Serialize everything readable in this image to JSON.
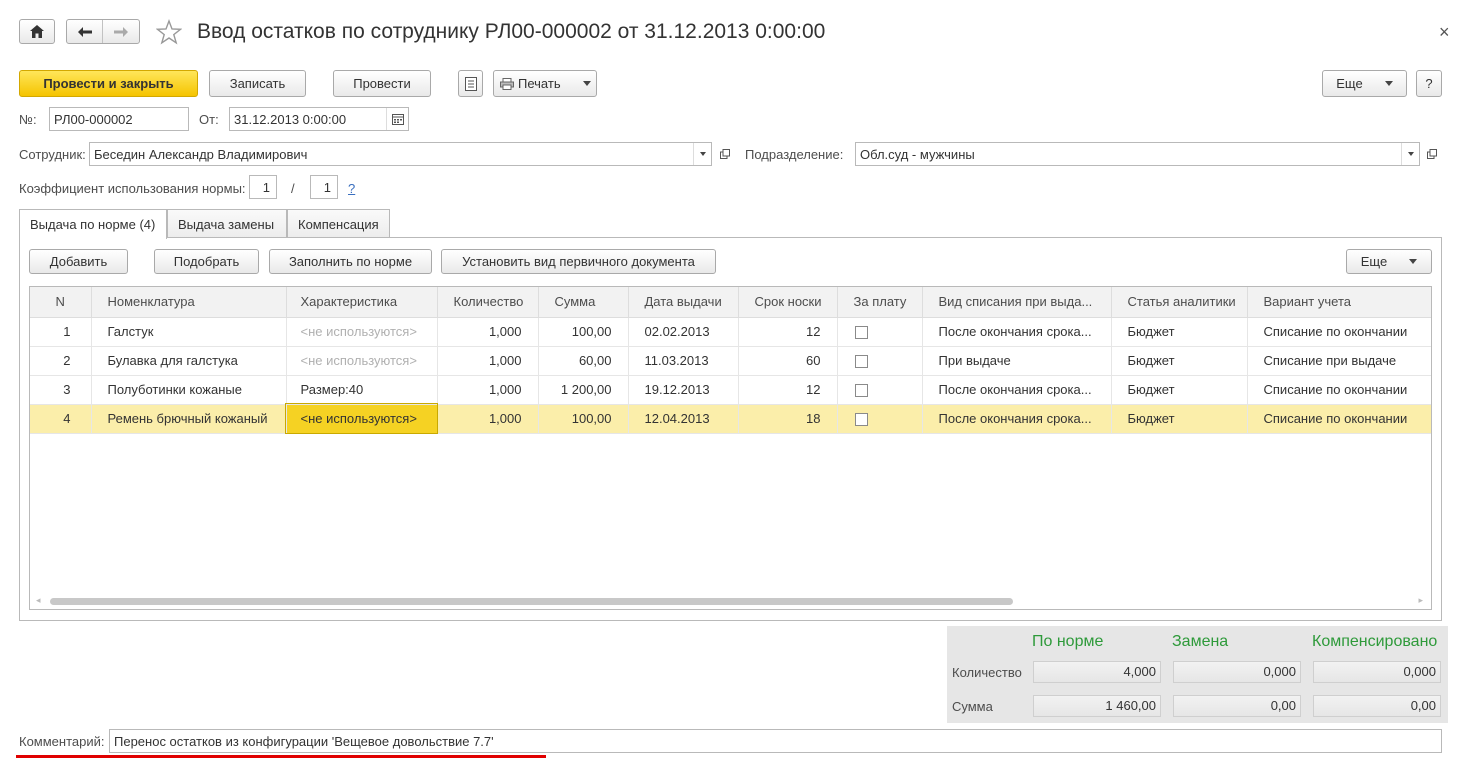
{
  "window": {
    "title": "Ввод остатков по сотруднику РЛ00-000002 от 31.12.2013 0:00:00"
  },
  "toolbar": {
    "post_close": "Провести и закрыть",
    "save": "Записать",
    "post": "Провести",
    "print": "Печать",
    "more": "Еще",
    "help": "?"
  },
  "header": {
    "number_label": "№:",
    "number_value": "РЛ00-000002",
    "date_label": "От:",
    "date_value": "31.12.2013  0:00:00",
    "employee_label": "Сотрудник:",
    "employee_value": "Беседин Александр Владимирович",
    "department_label": "Подразделение:",
    "department_value": "Обл.суд - мужчины",
    "coef_label": "Коэффициент использования нормы:",
    "coef_num": "1",
    "coef_sep": "/",
    "coef_den": "1",
    "coef_help": "?"
  },
  "tabs": [
    {
      "label": "Выдача по норме (4)"
    },
    {
      "label": "Выдача замены"
    },
    {
      "label": "Компенсация"
    }
  ],
  "table_toolbar": {
    "add": "Добавить",
    "pick": "Подобрать",
    "fill": "Заполнить по норме",
    "set_doc_type": "Установить вид первичного документа",
    "more": "Еще"
  },
  "table": {
    "columns": [
      "N",
      "Номенклатура",
      "Характеристика",
      "Количество",
      "Сумма",
      "Дата выдачи",
      "Срок носки",
      "За плату",
      "Вид списания при выда...",
      "Статья аналитики",
      "Вариант учета"
    ],
    "rows": [
      {
        "n": "1",
        "item": "Галстук",
        "char": "<не используются>",
        "qty": "1,000",
        "sum": "100,00",
        "date": "02.02.2013",
        "term": "12",
        "writeoff": "После окончания срока...",
        "article": "Бюджет",
        "variant": "Списание по окончании"
      },
      {
        "n": "2",
        "item": "Булавка для галстука",
        "char": "<не используются>",
        "qty": "1,000",
        "sum": "60,00",
        "date": "11.03.2013",
        "term": "60",
        "writeoff": "При выдаче",
        "article": "Бюджет",
        "variant": "Списание при выдаче"
      },
      {
        "n": "3",
        "item": "Полуботинки кожаные",
        "char": "Размер:40",
        "qty": "1,000",
        "sum": "1 200,00",
        "date": "19.12.2013",
        "term": "12",
        "writeoff": "После окончания срока...",
        "article": "Бюджет",
        "variant": "Списание по окончании"
      },
      {
        "n": "4",
        "item": "Ремень брючный кожаный",
        "char": "<не используются>",
        "qty": "1,000",
        "sum": "100,00",
        "date": "12.04.2013",
        "term": "18",
        "writeoff": "После окончания срока...",
        "article": "Бюджет",
        "variant": "Списание по окончании"
      }
    ]
  },
  "totals": {
    "head_norm": "По норме",
    "head_replace": "Замена",
    "head_comp": "Компенсировано",
    "qty_label": "Количество",
    "sum_label": "Сумма",
    "qty_norm": "4,000",
    "qty_replace": "0,000",
    "qty_comp": "0,000",
    "sum_norm": "1 460,00",
    "sum_replace": "0,00",
    "sum_comp": "0,00"
  },
  "comment": {
    "label": "Комментарий:",
    "value": "Перенос остатков из конфигурации 'Вещевое довольствие 7.7'"
  },
  "colors": {
    "accent_yellow": "#f5c400",
    "totals_green": "#2e9a3a",
    "underline_red": "#e00000"
  }
}
